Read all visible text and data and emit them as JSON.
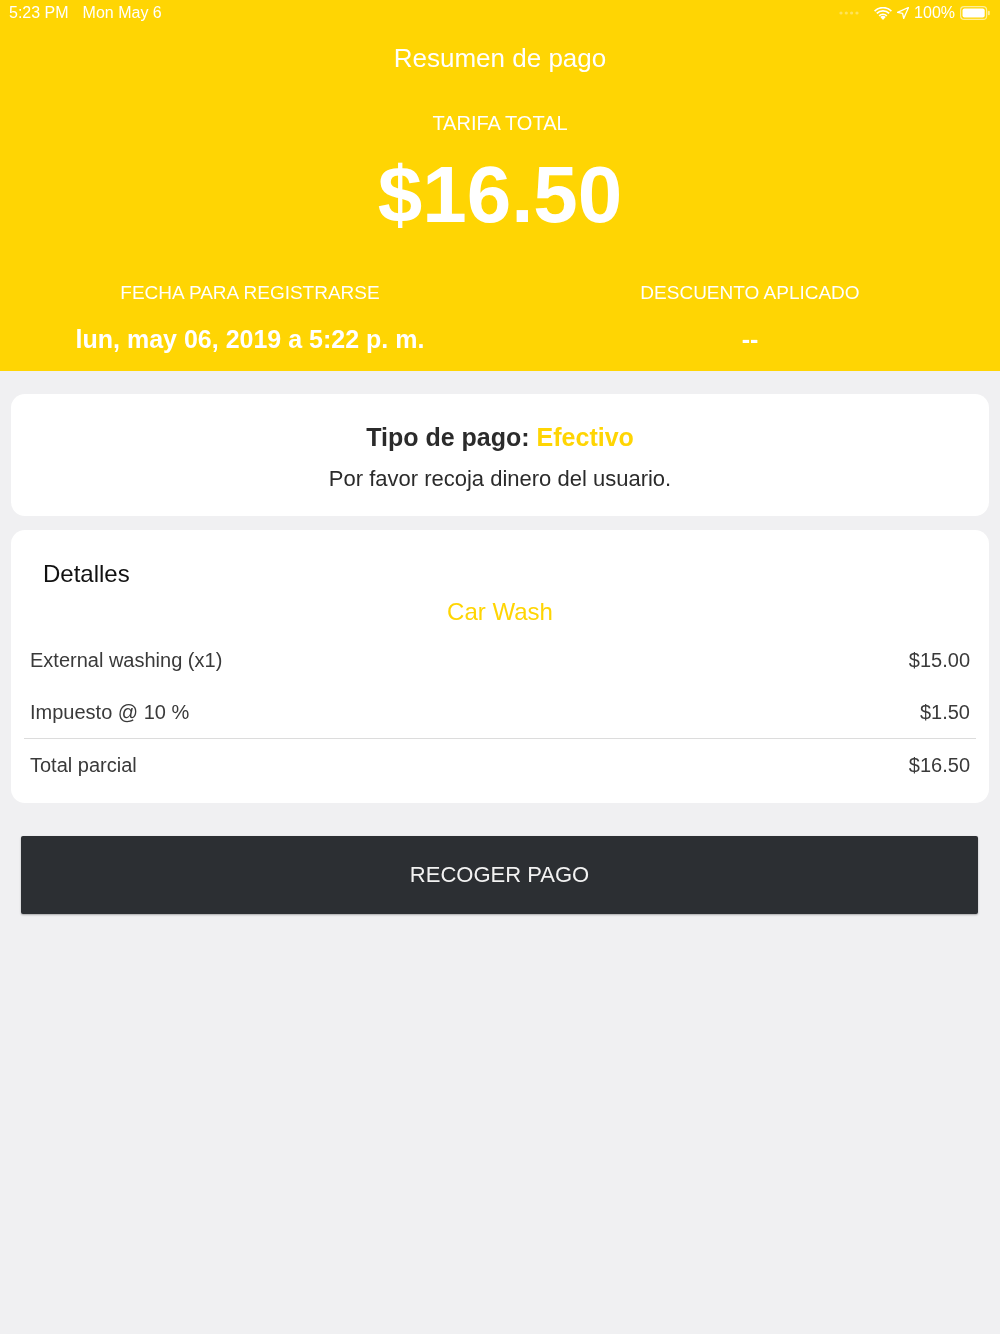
{
  "status_bar": {
    "time": "5:23 PM",
    "date": "Mon May 6",
    "battery": "100%"
  },
  "header": {
    "title": "Resumen de pago",
    "total_label": "TARIFA TOTAL",
    "total": "$16.50",
    "info": [
      {
        "label": "FECHA PARA REGISTRARSE",
        "value": "lun, may 06, 2019 a 5:22 p. m."
      },
      {
        "label": "DESCUENTO APLICADO",
        "value": "--"
      }
    ]
  },
  "payment": {
    "label": "Tipo de pago:",
    "value": "Efectivo",
    "note": "Por favor recoja dinero del usuario."
  },
  "details": {
    "title": "Detalles",
    "service": "Car Wash",
    "rows": [
      {
        "kind": "item",
        "label": "External washing (x1)",
        "amount": "$15.00"
      },
      {
        "kind": "item",
        "label": "Impuesto @ 10 %",
        "amount": "$1.50"
      },
      {
        "kind": "subtotal",
        "label": "Total parcial",
        "amount": "$16.50"
      }
    ]
  },
  "button": {
    "label": "RECOGER PAGO"
  }
}
